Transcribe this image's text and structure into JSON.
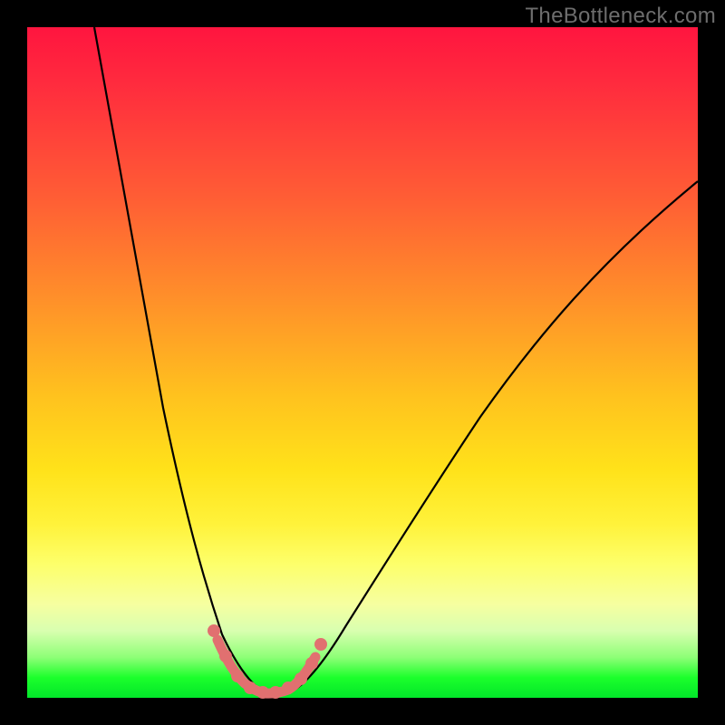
{
  "watermark": "TheBottleneck.com",
  "colors": {
    "frame": "#000000",
    "curve_stroke": "#000000",
    "marker_fill": "#e17070",
    "marker_stroke": "#e17070"
  },
  "chart_data": {
    "type": "line",
    "title": "",
    "xlabel": "",
    "ylabel": "",
    "xlim": [
      0,
      100
    ],
    "ylim": [
      0,
      100
    ],
    "grid": false,
    "legend": false,
    "background": "vertical-gradient red→green (bottleneck heatmap)",
    "series": [
      {
        "name": "bottleneck-curve",
        "description": "Black V-shaped curve; steep on left, shallower exponential rise on right. Vertical axis = bottleneck %, minimum ≈ 0 near x≈34.",
        "x": [
          10,
          12,
          15,
          18,
          20,
          22,
          25,
          28,
          30,
          32,
          34,
          36,
          38,
          40,
          43,
          47,
          52,
          58,
          65,
          72,
          80,
          88,
          96
        ],
        "values": [
          100,
          88,
          71,
          55,
          44,
          34,
          20,
          10,
          4,
          1,
          0,
          0,
          1,
          3,
          7,
          13,
          21,
          30,
          40,
          49,
          58,
          66,
          74
        ]
      },
      {
        "name": "optimal-zone-markers",
        "description": "Salmon-colored beaded segment along the bottom of the V indicating balanced / optimal range.",
        "x": [
          28.5,
          30.5,
          32.0,
          33.5,
          35.0,
          36.5,
          38.0,
          39.0,
          40.5,
          43.0
        ],
        "values": [
          8.5,
          4.0,
          1.5,
          0.7,
          0.5,
          0.5,
          0.8,
          1.5,
          3.0,
          7.0
        ]
      }
    ]
  }
}
